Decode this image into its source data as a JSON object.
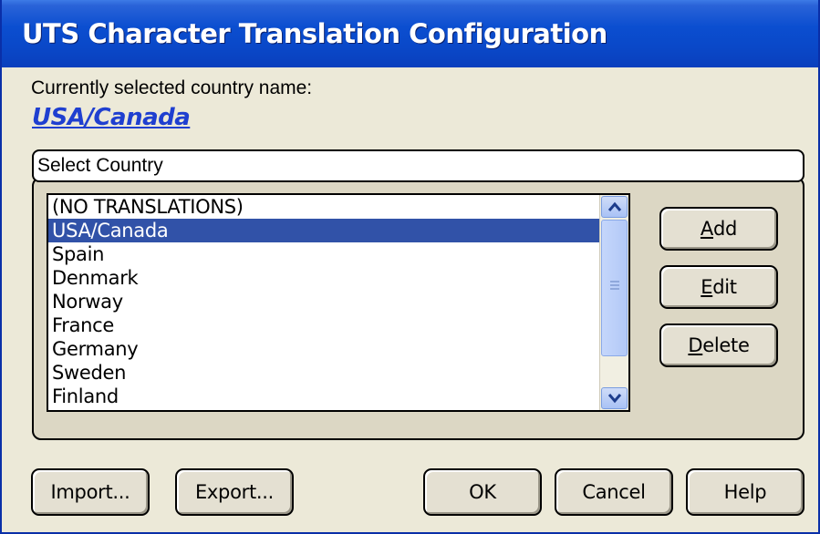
{
  "window": {
    "title": "UTS Character Translation Configuration"
  },
  "current": {
    "label": "Currently selected country name:",
    "value": "USA/Canada"
  },
  "group": {
    "title": "Select Country"
  },
  "countries": {
    "items": [
      "(NO TRANSLATIONS)",
      "USA/Canada",
      "Spain",
      "Denmark",
      "Norway",
      "France",
      "Germany",
      "Sweden",
      "Finland"
    ],
    "selected": "USA/Canada"
  },
  "buttons": {
    "add": {
      "accel": "A",
      "rest": "dd"
    },
    "edit": {
      "accel": "E",
      "rest": "dit"
    },
    "delete": {
      "accel": "D",
      "rest": "elete"
    },
    "import": "Import...",
    "export": "Export...",
    "ok": "OK",
    "cancel": "Cancel",
    "help": "Help"
  },
  "colors": {
    "titlebar": "#0b4ed0",
    "selection": "#3152a8",
    "link": "#1f3fd0"
  },
  "icons": {
    "scroll_up": "chevron-up-icon",
    "scroll_down": "chevron-down-icon"
  }
}
